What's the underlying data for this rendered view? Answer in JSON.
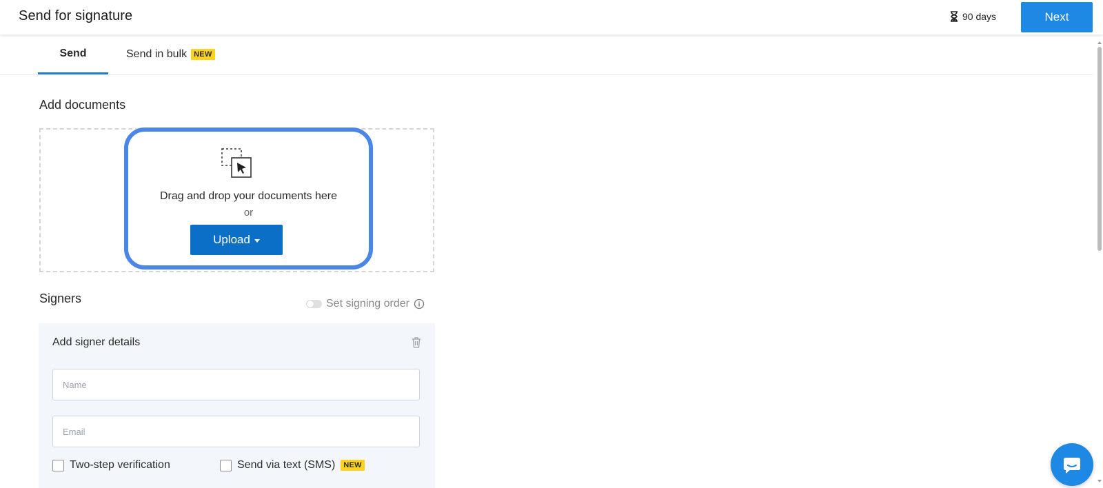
{
  "header": {
    "title": "Send for signature",
    "expiry": {
      "icon": "hourglass-icon",
      "label": "90 days"
    },
    "next_label": "Next"
  },
  "tabs": [
    {
      "label": "Send",
      "active": true
    },
    {
      "label": "Send in bulk",
      "badge": "NEW",
      "active": false
    }
  ],
  "documents": {
    "title": "Add documents",
    "drop_text": "Drag and drop your documents here",
    "or_text": "or",
    "upload_label": "Upload"
  },
  "signers": {
    "title": "Signers",
    "signing_order_label": "Set signing order",
    "card_title": "Add signer details",
    "name_placeholder": "Name",
    "email_placeholder": "Email",
    "two_step_label": "Two-step verification",
    "sms_label": "Send via text (SMS)",
    "sms_badge": "NEW"
  },
  "colors": {
    "primary": "#1e88e5",
    "upload": "#0b6fc8",
    "highlight": "#4a86e8",
    "badge": "#ffd21e"
  }
}
